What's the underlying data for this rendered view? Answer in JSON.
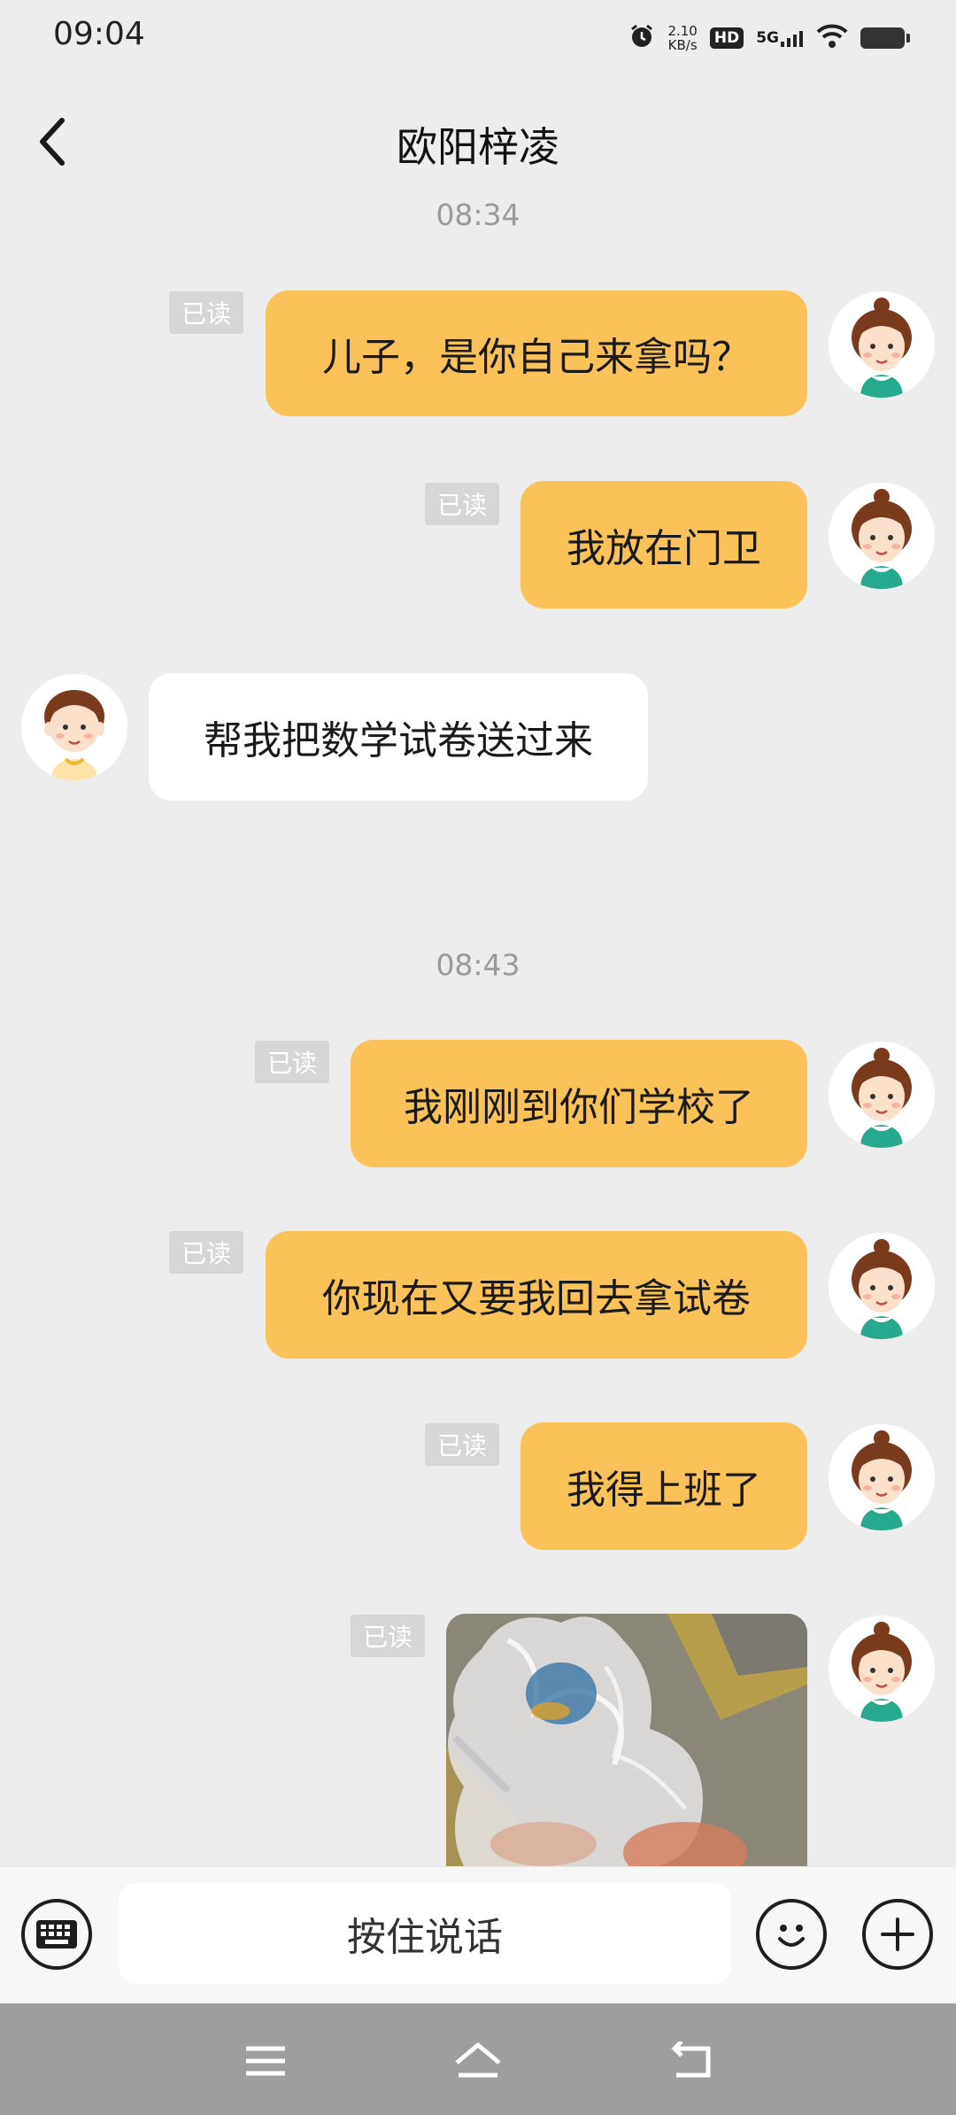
{
  "status": {
    "time": "09:04",
    "net_speed_value": "2.10",
    "net_speed_unit": "KB/s",
    "hd": "HD",
    "network": "5G"
  },
  "header": {
    "title": "欧阳梓凌"
  },
  "timestamps": [
    "08:34",
    "08:43"
  ],
  "read_label": "已读",
  "messages": [
    {
      "text": "儿子，是你自己来拿吗？"
    },
    {
      "text": "我放在门卫"
    },
    {
      "text": "帮我把数学试卷送过来"
    },
    {
      "text": "我刚刚到你们学校了"
    },
    {
      "text": "你现在又要我回去拿试卷"
    },
    {
      "text": "我得上班了"
    }
  ],
  "input": {
    "voice_label": "按住说话"
  },
  "colors": {
    "outgoing_bubble": "#fbc25a",
    "incoming_bubble": "#ffffff",
    "background": "#ededed"
  }
}
